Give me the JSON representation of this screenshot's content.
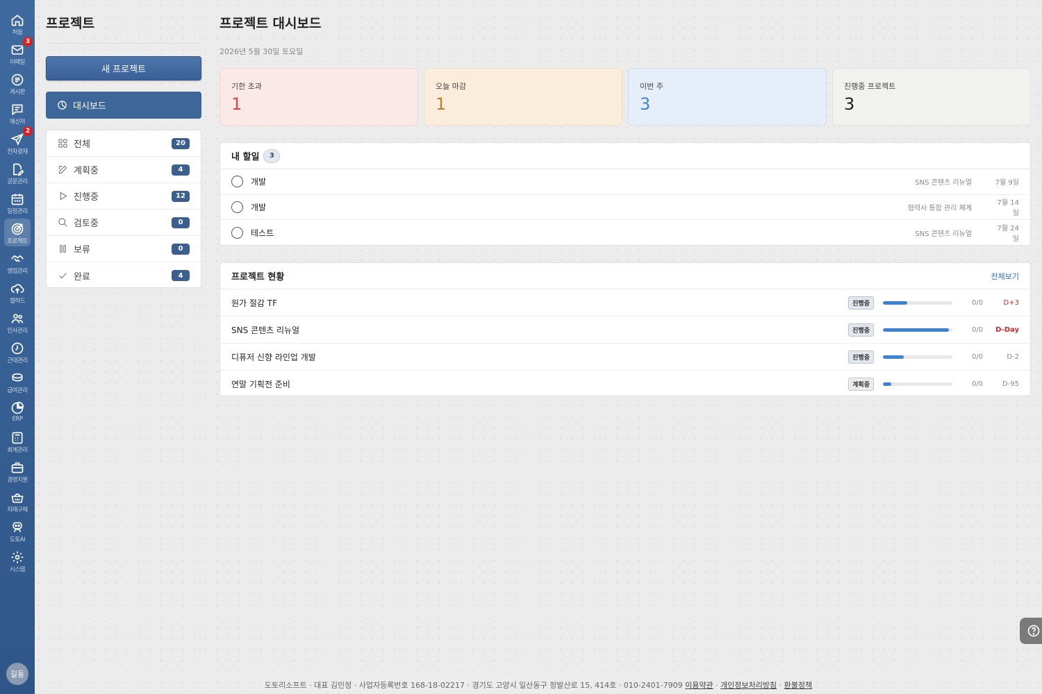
{
  "rail": {
    "items": [
      {
        "label": "처음",
        "icon": "home-icon"
      },
      {
        "label": "이메일",
        "icon": "mail-icon",
        "badge": "3"
      },
      {
        "label": "게시판",
        "icon": "board-icon"
      },
      {
        "label": "메신저",
        "icon": "messenger-icon"
      },
      {
        "label": "전자결재",
        "icon": "approval-icon",
        "badge": "2"
      },
      {
        "label": "공문관리",
        "icon": "document-icon"
      },
      {
        "label": "일정관리",
        "icon": "calendar-icon"
      },
      {
        "label": "프로젝트",
        "icon": "target-icon"
      },
      {
        "label": "영업관리",
        "icon": "handshake-icon"
      },
      {
        "label": "웹하드",
        "icon": "cloud-upload-icon"
      },
      {
        "label": "인사관리",
        "icon": "people-icon"
      },
      {
        "label": "근태관리",
        "icon": "clock-icon"
      },
      {
        "label": "급여관리",
        "icon": "coins-icon"
      },
      {
        "label": "ERP",
        "icon": "pie-chart-icon"
      },
      {
        "label": "회계관리",
        "icon": "calculator-icon"
      },
      {
        "label": "경영지원",
        "icon": "briefcase-icon"
      },
      {
        "label": "자재구매",
        "icon": "basket-icon"
      },
      {
        "label": "도토AI",
        "icon": "robot-icon"
      },
      {
        "label": "시스템",
        "icon": "gear-icon"
      }
    ],
    "avatar": "길동"
  },
  "sidebar": {
    "title": "프로젝트",
    "new_button": "새 프로젝트",
    "dashboard_button": "대시보드",
    "filters": [
      {
        "label": "전체",
        "count": "20",
        "icon": "grid-icon"
      },
      {
        "label": "계획중",
        "count": "4",
        "icon": "edit-icon"
      },
      {
        "label": "진행중",
        "count": "12",
        "icon": "play-icon"
      },
      {
        "label": "검토중",
        "count": "0",
        "icon": "search-icon"
      },
      {
        "label": "보류",
        "count": "0",
        "icon": "pause-icon"
      },
      {
        "label": "완료",
        "count": "4",
        "icon": "check-icon"
      }
    ]
  },
  "main": {
    "title": "프로젝트 대시보드",
    "date": "2026년 5월 30일 토요일",
    "stats": [
      {
        "label": "기한 초과",
        "value": "1"
      },
      {
        "label": "오늘 마감",
        "value": "1"
      },
      {
        "label": "이번 주",
        "value": "3"
      },
      {
        "label": "진행중 프로젝트",
        "value": "3"
      }
    ],
    "todo": {
      "title": "내 할일",
      "count": "3",
      "items": [
        {
          "task": "개발",
          "project": "SNS 콘텐츠 리뉴얼",
          "date": "7월 9일"
        },
        {
          "task": "개발",
          "project": "협력사 통합 관리 체계",
          "date": "7월 14일"
        },
        {
          "task": "테스트",
          "project": "SNS 콘텐츠 리뉴얼",
          "date": "7월 24일"
        }
      ]
    },
    "projects": {
      "title": "프로젝트 현황",
      "view_all": "전체보기",
      "items": [
        {
          "name": "원가 절감 TF",
          "status": "진행중",
          "progress": 0.35,
          "ratio": "0/0",
          "dday": "D+3"
        },
        {
          "name": "SNS 콘텐츠 리뉴얼",
          "status": "진행중",
          "progress": 0.95,
          "ratio": "0/0",
          "dday": "D-Day"
        },
        {
          "name": "디퓨저 신향 라인업 개발",
          "status": "진행중",
          "progress": 0.3,
          "ratio": "0/0",
          "dday": "D-2"
        },
        {
          "name": "연말 기획전 준비",
          "status": "계획중",
          "progress": 0.12,
          "ratio": "0/0",
          "dday": "D-95"
        }
      ]
    }
  },
  "footer": {
    "text": "도토리소프트 · 대표 김민정 · 사업자등록번호 168-18-02217 · 경기도 고양시 일산동구 정발산로 15, 414호 · 010-2401-7909",
    "sep": "·",
    "links": [
      "이용약관",
      "개인정보처리방침",
      "환불정책"
    ]
  }
}
